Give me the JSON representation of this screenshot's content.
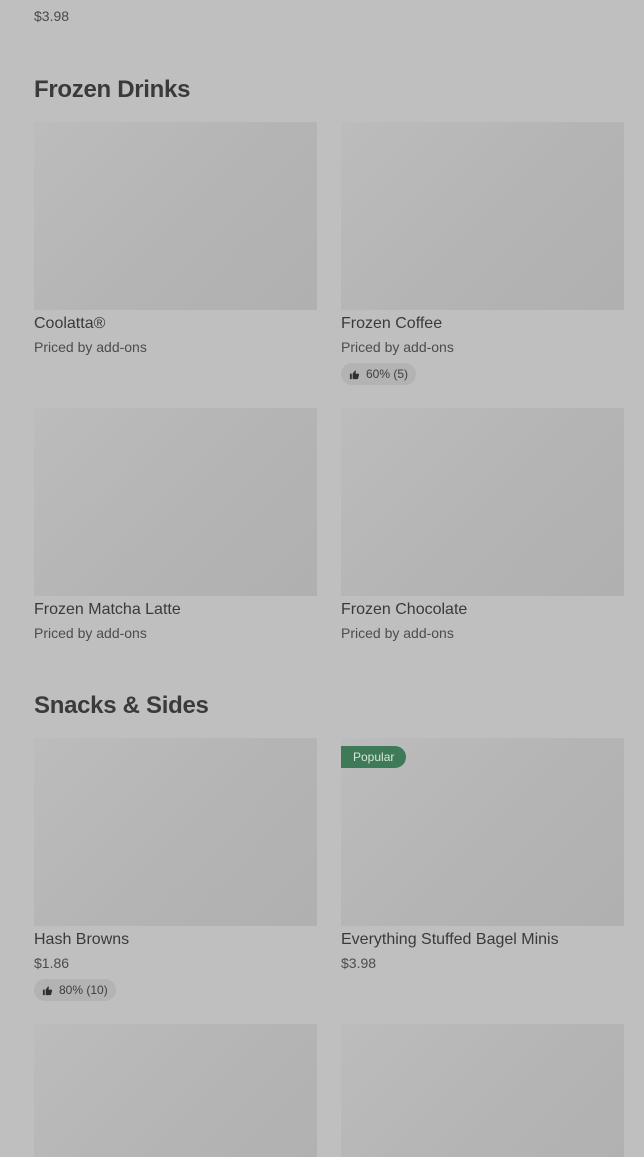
{
  "top_item": {
    "price": "$3.98"
  },
  "sections": [
    {
      "title": "Frozen Drinks",
      "items": [
        {
          "name": "Coolatta®",
          "price": "Priced by add-ons"
        },
        {
          "name": "Frozen Coffee",
          "price": "Priced by add-ons",
          "rating": "60% (5)"
        },
        {
          "name": "Frozen Matcha Latte",
          "price": "Priced by add-ons"
        },
        {
          "name": "Frozen Chocolate",
          "price": "Priced by add-ons"
        }
      ]
    },
    {
      "title": "Snacks & Sides",
      "items": [
        {
          "name": "Hash Browns",
          "price": "$1.86",
          "rating": "80% (10)"
        },
        {
          "name": "Everything Stuffed Bagel Minis",
          "price": "$3.98",
          "badge": "Popular"
        },
        {
          "name": "",
          "price": ""
        },
        {
          "name": "",
          "price": ""
        }
      ]
    }
  ],
  "icons": {
    "rating": "thumbs-up-icon"
  },
  "colors": {
    "badge_bg": "#3e7a58",
    "page_bg": "#bfbfbf"
  }
}
